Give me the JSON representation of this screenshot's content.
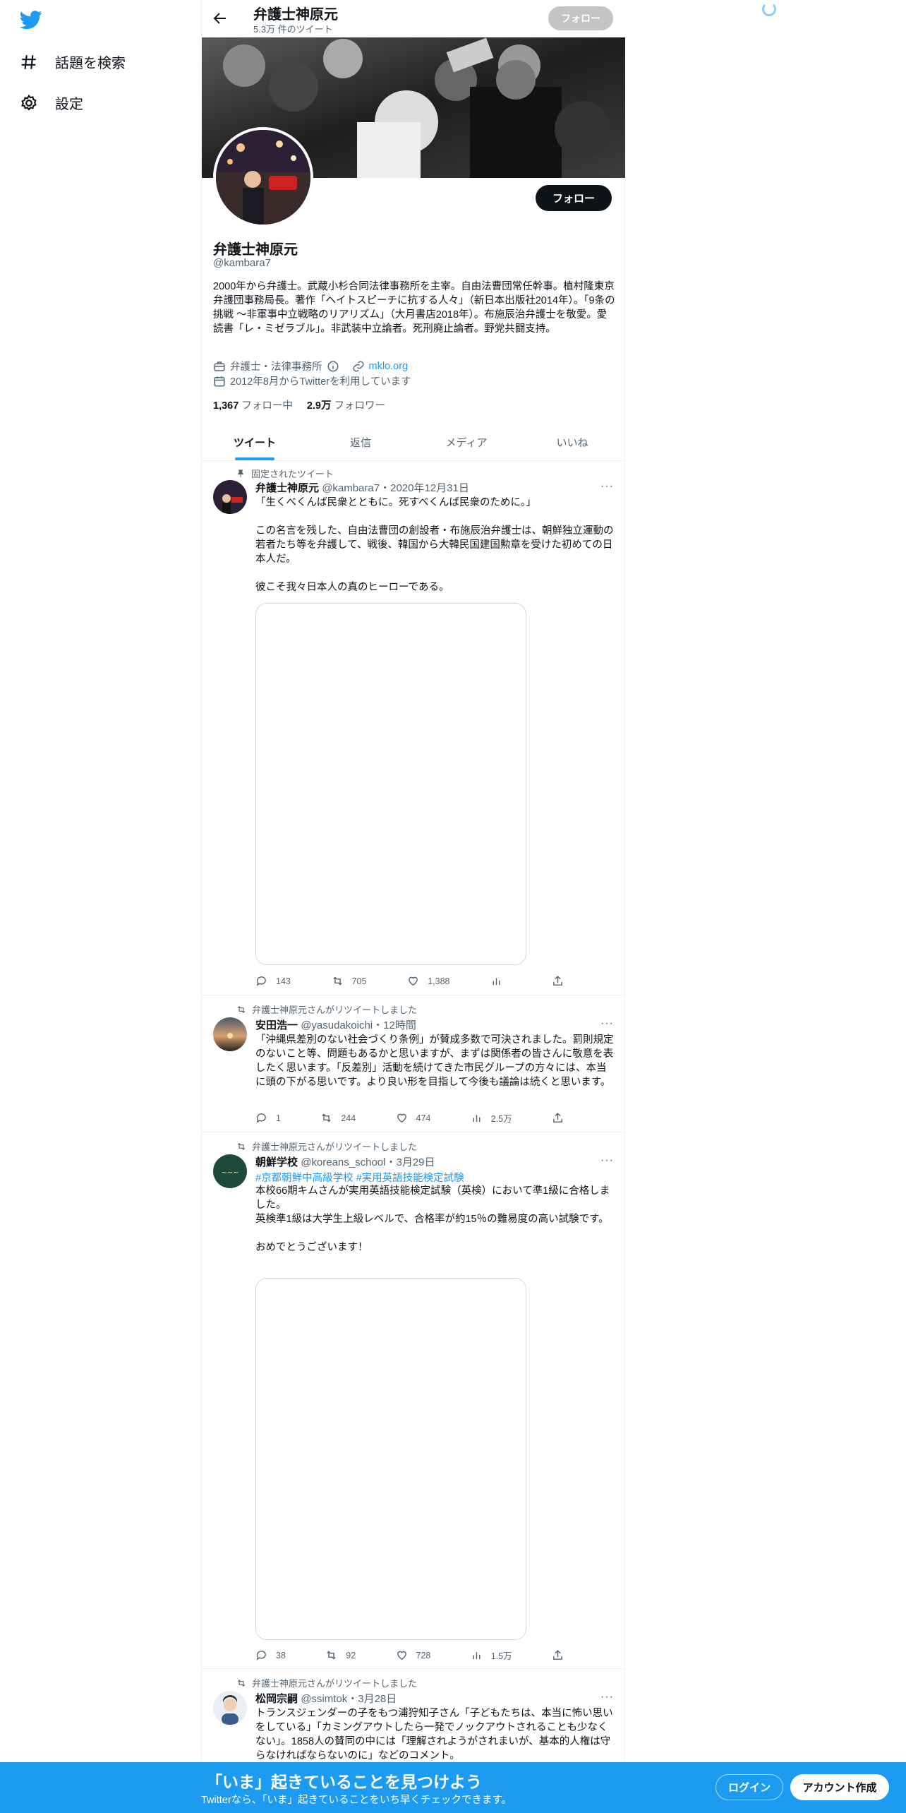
{
  "nav": {
    "explore_label": "話題を検索",
    "settings_label": "設定"
  },
  "header": {
    "name": "弁護士神原元",
    "tweet_count": "5.3万 件のツイート",
    "follow_label": "フォロー"
  },
  "profile": {
    "name": "弁護士神原元",
    "handle": "@kambara7",
    "follow_label": "フォロー",
    "bio": "2000年から弁護士。武蔵小杉合同法律事務所を主宰。自由法曹団常任幹事。植村隆東京弁護団事務局長。著作「ヘイトスピーチに抗する人々」（新日本出版社2014年）。「9条の挑戦 ～非軍事中立戦略のリアリズム」（大月書店2018年）。布施辰治弁護士を敬愛。愛読書「レ・ミゼラブル」。非武装中立論者。死刑廃止論者。野党共闘支持。",
    "category": "弁護士・法律事務所",
    "website": "mklo.org",
    "joined": "2012年8月からTwitterを利用しています",
    "following_count": "1,367",
    "following_label": "フォロー中",
    "followers_count": "2.9万",
    "followers_label": "フォロワー"
  },
  "tabs": [
    {
      "label": "ツイート",
      "active": true
    },
    {
      "label": "返信",
      "active": false
    },
    {
      "label": "メディア",
      "active": false
    },
    {
      "label": "いいね",
      "active": false
    }
  ],
  "tweets": [
    {
      "context": "固定されたツイート",
      "name": "弁護士神原元",
      "meta": "@kambara7・2020年12月31日",
      "text": "「生くべくんば民衆とともに。死すべくんば民衆のために。」\n\nこの名言を残した、自由法曹団の創設者・布施辰治弁護士は、朝鮮独立運動の若者たち等を弁護して、戦後、韓国から大韓民国建国勲章を受けた初めての日本人だ。\n\n彼こそ我々日本人の真のヒーローである。",
      "replies": "143",
      "retweets": "705",
      "likes": "1,388",
      "views": ""
    },
    {
      "context": "弁護士神原元さんがリツイートしました",
      "name": "安田浩一",
      "meta": "@yasudakoichi・12時間",
      "text": "「沖縄県差別のない社会づくり条例」が賛成多数で可決されました。罰則規定のないこと等、問題もあるかと思いますが、まずは関係者の皆さんに敬意を表したく思います。「反差別」活動を続けてきた市民グループの方々には、本当に頭の下がる思いです。より良い形を目指して今後も議論は続くと思います。",
      "replies": "1",
      "retweets": "244",
      "likes": "474",
      "views": "2.5万"
    },
    {
      "context": "弁護士神原元さんがリツイートしました",
      "name": "朝鮮学校",
      "meta": "@koreans_school・3月29日",
      "hashtags": "#京都朝鮮中高級学校 #実用英語技能検定試験",
      "text": "本校66期キムさんが実用英語技能検定試験（英検）において準1級に合格しました。\n英検準1級は大学生上級レベルで、合格率が約15％の難易度の高い試験です。\n\nおめでとうございます！",
      "replies": "38",
      "retweets": "92",
      "likes": "728",
      "views": "1.5万"
    },
    {
      "context": "弁護士神原元さんがリツイートしました",
      "name": "松岡宗嗣",
      "meta": "@ssimtok・3月28日",
      "text": "トランスジェンダーの子をもつ浦狩知子さん「子どもたちは、本当に怖い思いをしている」「カミングアウトしたら一発でノックアウトされることも少なくない」。1858人の賛同の中には「理解されようがされまいが、基本的人権は守らなければならないのに」などのコメント。"
    }
  ],
  "bottom_bar": {
    "title": "「いま」起きていることを見つけよう",
    "subtitle": "Twitterなら、「いま」起きていることをいち早くチェックできます。",
    "login_label": "ログイン",
    "signup_label": "アカウント作成"
  },
  "colors": {
    "accent": "#1d9bf0",
    "text_primary": "#0f1419",
    "text_secondary": "#536471"
  }
}
